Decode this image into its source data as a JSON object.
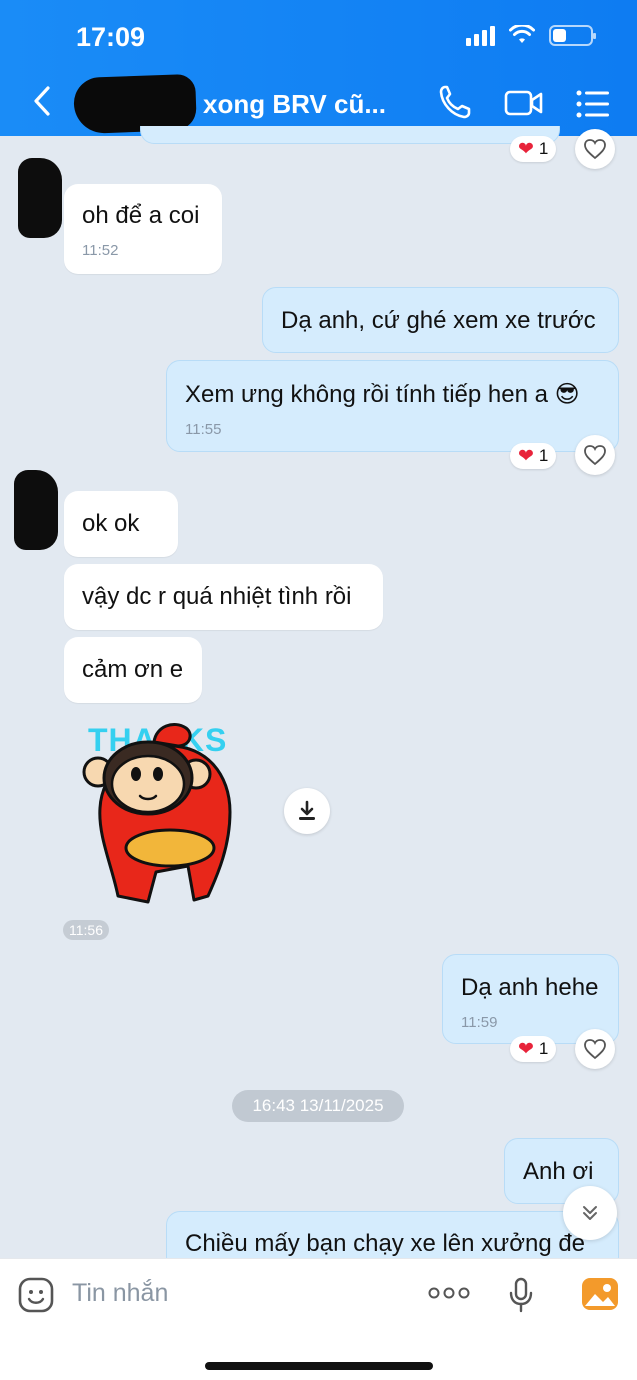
{
  "status_bar": {
    "time": "17:09"
  },
  "header": {
    "title": "xong BRV cũ..."
  },
  "messages": [
    {
      "text": "oh để a coi",
      "time": "11:52"
    },
    {
      "text": "Dạ anh, cứ ghé xem xe trước"
    },
    {
      "text": "Xem ưng không rồi tính tiếp hen a 😎",
      "time": "11:55",
      "reaction_count": "1"
    },
    {
      "text": "ok ok"
    },
    {
      "text": "vậy dc r quá nhiệt tình rồi"
    },
    {
      "text": "cảm ơn e"
    },
    {
      "text": "Dạ anh hehe",
      "time": "11:59",
      "reaction_count": "1"
    },
    {
      "text": "Anh ơi"
    },
    {
      "text": "Chiều mấy bạn chạy xe lên xưởng đe"
    }
  ],
  "top_partial_reaction_count": "1",
  "sticker": {
    "text": "THANKS",
    "time": "11:56"
  },
  "date_separator": "16:43 13/11/2025",
  "input": {
    "placeholder": "Tin nhắn"
  },
  "colors": {
    "header": "#1a8cf7",
    "background": "#e2e9f1",
    "outgoing_bubble": "#d5ecfd",
    "incoming_bubble": "#ffffff",
    "sticker_red": "#e8271a",
    "sticker_text": "#35d0f0"
  }
}
